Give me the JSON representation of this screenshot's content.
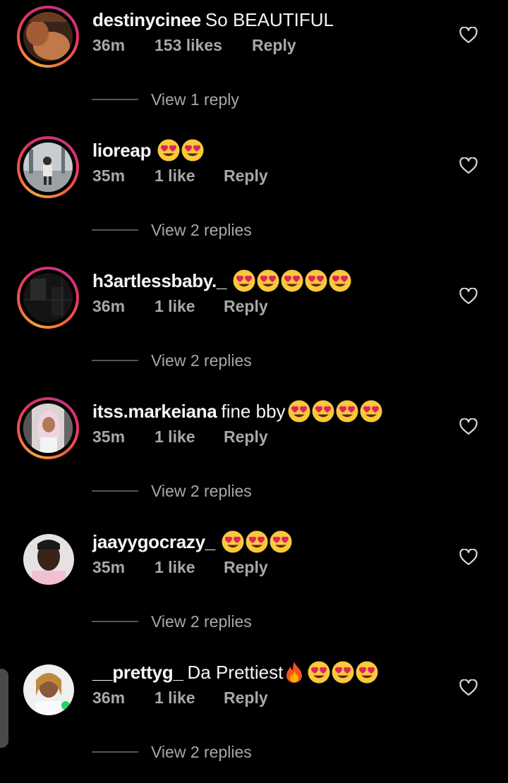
{
  "comments": [
    {
      "username": "destinycinee",
      "text": "So BEAUTIFUL",
      "emojis": [],
      "time": "36m",
      "likes": "153 likes",
      "reply": "Reply",
      "view_replies": "View 1 reply",
      "story_ring": true
    },
    {
      "username": "lioreap",
      "text": "",
      "emojis": [
        "heart-eyes",
        "heart-eyes"
      ],
      "time": "35m",
      "likes": "1 like",
      "reply": "Reply",
      "view_replies": "View 2 replies",
      "story_ring": true
    },
    {
      "username": "h3artlessbaby._",
      "text": "",
      "emojis": [
        "heart-eyes",
        "heart-eyes",
        "heart-eyes",
        "heart-eyes",
        "heart-eyes"
      ],
      "time": "36m",
      "likes": "1 like",
      "reply": "Reply",
      "view_replies": "View 2 replies",
      "story_ring": true
    },
    {
      "username": "itss.markeiana",
      "text": "fine bby",
      "emojis": [
        "heart-eyes",
        "heart-eyes",
        "heart-eyes",
        "heart-eyes"
      ],
      "time": "35m",
      "likes": "1 like",
      "reply": "Reply",
      "view_replies": "View 2 replies",
      "story_ring": true
    },
    {
      "username": "jaayygocrazy_",
      "text": "",
      "emojis": [
        "heart-eyes",
        "heart-eyes",
        "heart-eyes"
      ],
      "time": "35m",
      "likes": "1 like",
      "reply": "Reply",
      "view_replies": "View 2 replies",
      "story_ring": false
    },
    {
      "username": "__prettyg_",
      "text": "Da Prettiest",
      "emojis": [
        "fire",
        "heart-eyes",
        "heart-eyes",
        "heart-eyes"
      ],
      "time": "36m",
      "likes": "1 like",
      "reply": "Reply",
      "view_replies": "View 2 replies",
      "story_ring": false
    }
  ],
  "colors": {
    "background": "#000000",
    "primary_text": "#f5f5f5",
    "secondary_text": "#a8a8a8",
    "story_ring_start": "#f7a33a",
    "story_ring_end": "#c13584",
    "emoji_face": "#f9c93c",
    "emoji_heart": "#e0245e"
  },
  "icons": {
    "like": "heart-outline-icon"
  }
}
